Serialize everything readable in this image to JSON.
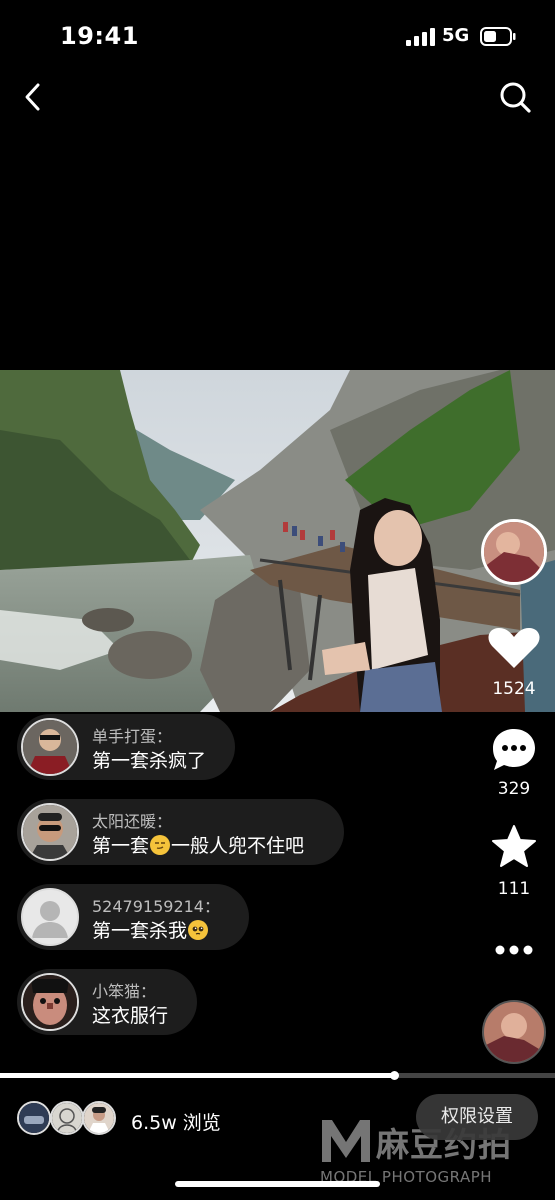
{
  "status_bar": {
    "time": "19:41",
    "network": "5G"
  },
  "post": {
    "likes": "1524",
    "comments_count": "329",
    "favorites": "111",
    "progress_percent": 71
  },
  "comments": [
    {
      "name": "单手打蛋：",
      "text": "第一套杀疯了",
      "emoji": ""
    },
    {
      "name": "太阳还暖：",
      "text_before": "第一套",
      "text_after": "一般人兜不住吧"
    },
    {
      "name": "52479159214：",
      "text": "第一套杀我"
    },
    {
      "name": "小笨猫：",
      "text": "这衣服行"
    }
  ],
  "footer": {
    "views": "6.5w 浏览",
    "permission_label": "权限设置"
  },
  "watermark": {
    "brand": "麻豆约拍",
    "subtitle": "MODEL PHOTOGRAPH"
  },
  "colors": {
    "background": "#000000",
    "bubble": "#1d1d1d",
    "accent": "#ffffff"
  }
}
